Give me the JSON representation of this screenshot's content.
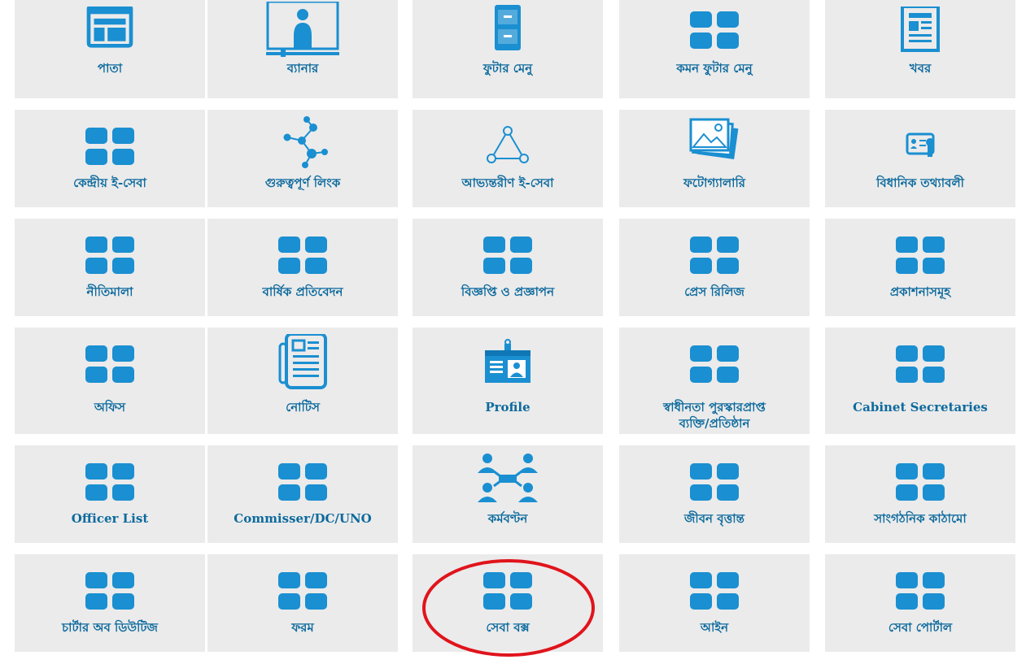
{
  "colors": {
    "icon_blue": "#1a8fd1",
    "label_blue": "#0d6a9d",
    "tile_bg": "#ebebeb",
    "annotation_red": "#e0141c"
  },
  "tiles": [
    {
      "id": "pata",
      "label": "পাতা",
      "icon": "web-page-icon"
    },
    {
      "id": "banner",
      "label": "ব্যানার",
      "icon": "banner-icon"
    },
    {
      "id": "footer-menu",
      "label": "ফুটার মেনু",
      "icon": "cabinet-icon"
    },
    {
      "id": "common-footer-menu",
      "label": "কমন ফুটার মেনু",
      "icon": "grid-icon"
    },
    {
      "id": "news",
      "label": "খবর",
      "icon": "newspaper-icon"
    },
    {
      "id": "central-eservice",
      "label": "কেন্দ্রীয় ই-সেবা",
      "icon": "grid-icon"
    },
    {
      "id": "important-links",
      "label": "গুরুত্বপূর্ণ লিংক",
      "icon": "network-icon"
    },
    {
      "id": "internal-eservice",
      "label": "আভ্যন্তরীণ ই-সেবা",
      "icon": "triangle-network-icon"
    },
    {
      "id": "photo-gallery",
      "label": "ফটোগ্যালারি",
      "icon": "photos-icon"
    },
    {
      "id": "statutory-info",
      "label": "বিধানিক তথ্যাবলী",
      "icon": "certificate-icon"
    },
    {
      "id": "policy",
      "label": "নীতিমালা",
      "icon": "grid-icon"
    },
    {
      "id": "annual-report",
      "label": "বার্ষিক প্রতিবেদন",
      "icon": "grid-icon"
    },
    {
      "id": "notification",
      "label": "বিজ্ঞপ্তি ও প্রজ্ঞাপন",
      "icon": "grid-icon"
    },
    {
      "id": "press-release",
      "label": "প্রেস রিলিজ",
      "icon": "grid-icon"
    },
    {
      "id": "publications",
      "label": "প্রকাশনাসমূহ",
      "icon": "grid-icon"
    },
    {
      "id": "office",
      "label": "অফিস",
      "icon": "grid-icon"
    },
    {
      "id": "notice",
      "label": "নোটিস",
      "icon": "notice-icon"
    },
    {
      "id": "profile",
      "label": "Profile",
      "icon": "id-card-icon"
    },
    {
      "id": "independence-award",
      "label": "স্বাধীনতা পুরস্কারপ্রাপ্ত\nব্যক্তি/প্রতিষ্ঠান",
      "icon": "grid-icon"
    },
    {
      "id": "cabinet-secretaries",
      "label": "Cabinet Secretaries",
      "icon": "grid-icon"
    },
    {
      "id": "officer-list",
      "label": "Officer List",
      "icon": "grid-icon"
    },
    {
      "id": "commissioner-dc-uno",
      "label": "Commisser/DC/UNO",
      "icon": "grid-icon"
    },
    {
      "id": "work-distribution",
      "label": "কর্মবণ্টন",
      "icon": "people-network-icon"
    },
    {
      "id": "biography",
      "label": "জীবন বৃত্তান্ত",
      "icon": "grid-icon"
    },
    {
      "id": "organogram",
      "label": "সাংগঠনিক কাঠামো",
      "icon": "grid-icon"
    },
    {
      "id": "charter-of-duties",
      "label": "চার্টার অব ডিউটিজ",
      "icon": "grid-icon"
    },
    {
      "id": "forms",
      "label": "ফরম",
      "icon": "grid-icon"
    },
    {
      "id": "service-box",
      "label": "সেবা বক্স",
      "icon": "grid-icon"
    },
    {
      "id": "law",
      "label": "আইন",
      "icon": "grid-icon"
    },
    {
      "id": "service-portal",
      "label": "সেবা পোর্টাল",
      "icon": "grid-icon"
    }
  ],
  "highlighted_tile": "service-box"
}
